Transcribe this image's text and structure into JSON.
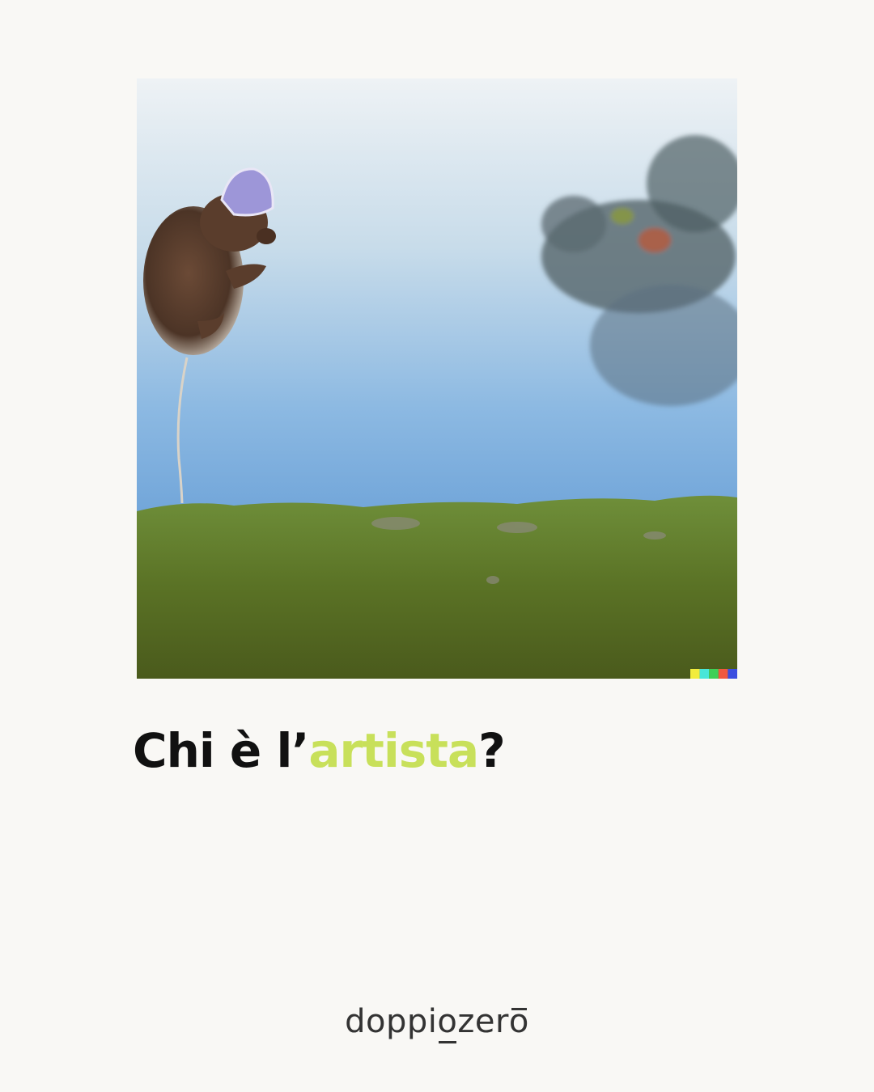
{
  "headline": {
    "part1": "Chi è l’",
    "accent": "artista",
    "part2": "?"
  },
  "logo": {
    "part1": "doppi",
    "underlined": "o",
    "part2": "zer",
    "overlined": "o"
  },
  "colors": {
    "background": "#f9f8f5",
    "headline": "#111111",
    "accent": "#c8e05a",
    "logo": "#333333"
  },
  "image": {
    "signature_colors": [
      "#f2ec3c",
      "#47e6d8",
      "#3fcf57",
      "#f0583f",
      "#3b4ee0"
    ]
  }
}
